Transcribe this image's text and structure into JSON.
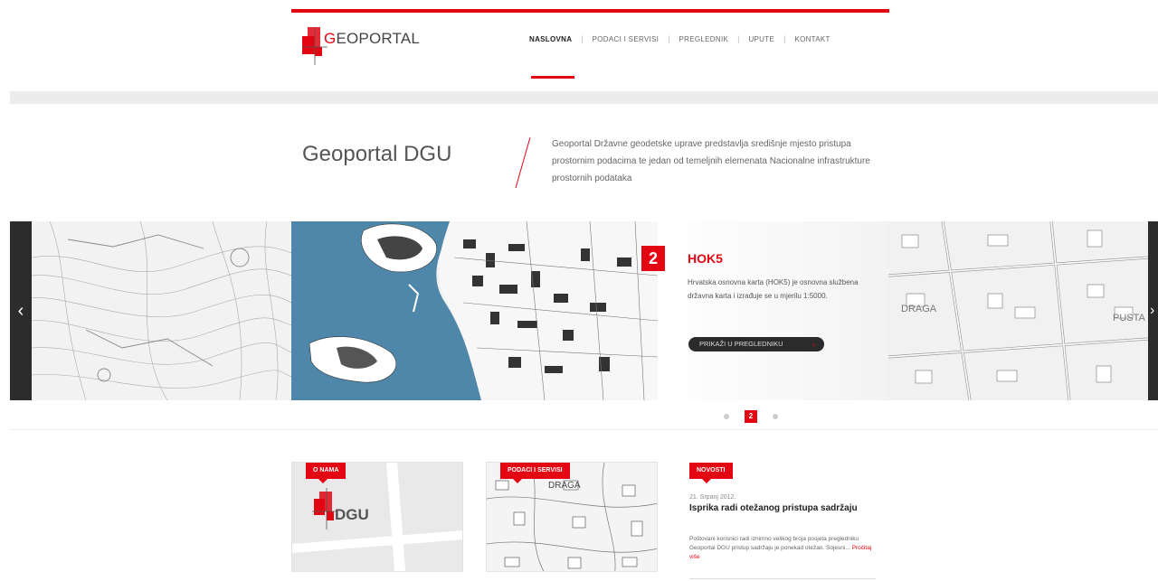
{
  "brand": {
    "logo_text_first": "G",
    "logo_text_rest": "EOPORTAL",
    "accent": "#e30613"
  },
  "nav": {
    "items": [
      {
        "label": "NASLOVNA",
        "active": true
      },
      {
        "label": "PODACI I SERVISI",
        "active": false
      },
      {
        "label": "PREGLEDNIK",
        "active": false
      },
      {
        "label": "UPUTE",
        "active": false
      },
      {
        "label": "KONTAKT",
        "active": false
      }
    ],
    "separator": "|"
  },
  "intro": {
    "title": "Geoportal DGU",
    "text": "Geoportal Državne geodetske uprave predstavlja središnje mjesto pristupa prostornim podacima te jedan od temeljnih elemenata Nacionalne infrastrukture prostornih podataka"
  },
  "slider": {
    "prev_icon": "chevron-left-icon",
    "next_icon": "chevron-right-icon",
    "prev_glyph": "‹",
    "next_glyph": "›",
    "slide_number": "2",
    "slide_title": "HOK5",
    "slide_text": "Hrvatska osnovna karta (HOK5) je osnovna službena državna karta i izrađuje se u mjerilu 1:5000.",
    "button_label": "PRIKAŽI U PREGLEDNIKU",
    "button_arrow": "›",
    "map_label_draga": "DRAGA",
    "map_label_pusta": "PUSTA",
    "dots": [
      {
        "label": "",
        "active": false
      },
      {
        "label": "2",
        "active": true
      },
      {
        "label": "",
        "active": false
      }
    ]
  },
  "cards": [
    {
      "badge": "O NAMA",
      "logo_text": "DGU"
    },
    {
      "badge": "PODACI I SERVISI",
      "map_label": "DRAGA"
    },
    {
      "badge": "NOVOSTI"
    }
  ],
  "news": {
    "date": "21. Srpanj 2012.",
    "title": "Isprika radi otežanog pristupa sadržaju",
    "body": "Poštovani korisnici radi iznimno velikog broja posjeta pregledniku Geoportal DGU pristup sadržaju je ponekad otežan. Sojesni...",
    "more": "Pročitaj više"
  }
}
